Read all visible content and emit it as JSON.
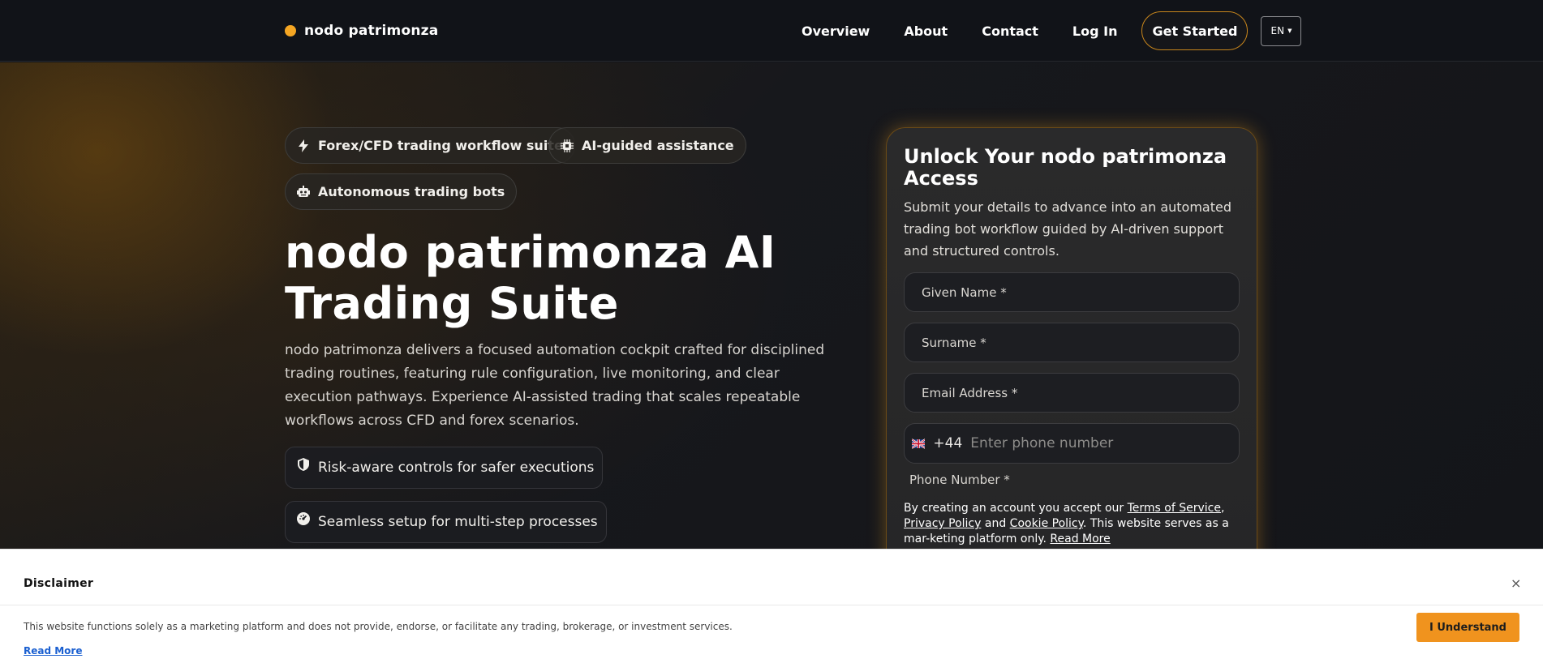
{
  "header": {
    "brand": "nodo patrimonza",
    "nav": [
      "Overview",
      "About",
      "Contact",
      "Log In"
    ],
    "cta": "Get Started",
    "language": "EN"
  },
  "hero": {
    "chips": [
      {
        "label": "Forex/CFD trading workflow suite",
        "icon": "bolt-icon"
      },
      {
        "label": "AI-guided assistance",
        "icon": "chip-icon"
      },
      {
        "label": "Autonomous trading bots",
        "icon": "robot-icon"
      }
    ],
    "title_line1": "nodo patrimonza AI",
    "title_line2": "Trading Suite",
    "description": "nodo patrimonza delivers a focused automation cockpit crafted for disciplined trading routines, featuring rule configuration, live monitoring, and clear execution pathways. Experience AI-assisted trading that scales repeatable workflows across CFD and forex scenarios.",
    "features": [
      {
        "label": "Risk-aware controls for safer executions",
        "icon": "shield-icon"
      },
      {
        "label": "Seamless setup for multi-step processes",
        "icon": "gauge-icon"
      }
    ]
  },
  "form": {
    "title": "Unlock Your nodo patrimonza Access",
    "subtitle": "Submit your details to advance into an automated trading bot workflow guided by AI-driven support and structured controls.",
    "given_name": "Given Name *",
    "surname": "Surname *",
    "email": "Email Address *",
    "dial_code": "+44",
    "phone_placeholder": "Enter phone number",
    "phone_label": "Phone Number *",
    "terms_prefix": "By creating an account you accept our ",
    "terms_link": "Terms of Service",
    "privacy_link": "Privacy Policy",
    "and": " and ",
    "cookie_link": "Cookie Policy",
    "terms_suffix": ". This website serves as a mar-keting platform only. ",
    "read_more": "Read More"
  },
  "disclaimer": {
    "title": "Disclaimer",
    "close": "×",
    "text": "This website functions solely as a marketing platform and does not provide, endorse, or facilitate any trading, brokerage, or investment services.",
    "read_more": "Read More",
    "button": "I Understand"
  },
  "colors": {
    "accent": "#f5a623",
    "button": "#f0931e",
    "link": "#1a5fd0"
  }
}
